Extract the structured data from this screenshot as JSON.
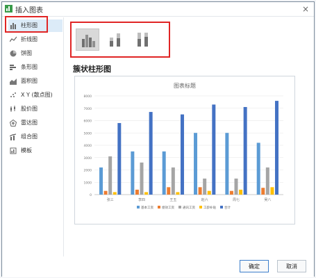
{
  "dialog": {
    "title": "插入图表",
    "close_glyph": "×"
  },
  "nav": {
    "items": [
      {
        "label": "柱形图",
        "icon": "column-chart-icon",
        "selected": true
      },
      {
        "label": "折线图",
        "icon": "line-chart-icon"
      },
      {
        "label": "饼图",
        "icon": "pie-chart-icon"
      },
      {
        "label": "条形图",
        "icon": "bar-chart-icon"
      },
      {
        "label": "面积图",
        "icon": "area-chart-icon"
      },
      {
        "label": "X Y (散点图)",
        "icon": "scatter-chart-icon"
      },
      {
        "label": "股价图",
        "icon": "stock-chart-icon"
      },
      {
        "label": "雷达图",
        "icon": "radar-chart-icon"
      },
      {
        "label": "组合图",
        "icon": "combo-chart-icon"
      },
      {
        "label": "模板",
        "icon": "template-icon"
      }
    ]
  },
  "subtypes": [
    "clustered-column",
    "stacked-column",
    "percent-stacked-column"
  ],
  "section_title": "簇状柱形图",
  "buttons": {
    "ok": "确定",
    "cancel": "取消"
  },
  "colors": {
    "accent_red": "#e02424",
    "series": [
      "#5b9bd5",
      "#ed7d31",
      "#a5a5a5",
      "#ffc000",
      "#4472c4"
    ]
  },
  "chart_data": {
    "type": "bar",
    "title": "图表标题",
    "categories": [
      "张三",
      "李四",
      "王五",
      "赵六",
      "周七",
      "吴八"
    ],
    "series": [
      {
        "name": "基本工资",
        "values": [
          2200,
          3500,
          3500,
          5000,
          5000,
          4200
        ]
      },
      {
        "name": "绩效工资",
        "values": [
          300,
          400,
          600,
          600,
          300,
          550
        ]
      },
      {
        "name": "通讯工资",
        "values": [
          3100,
          2600,
          2200,
          1300,
          1300,
          2200
        ]
      },
      {
        "name": "工龄补贴",
        "values": [
          200,
          200,
          200,
          300,
          400,
          600
        ]
      },
      {
        "name": "合计",
        "values": [
          5800,
          6700,
          6500,
          7300,
          7100,
          7600
        ]
      }
    ],
    "yticks": [
      "0",
      "1000",
      "2000",
      "3000",
      "4000",
      "5000",
      "6000",
      "7000",
      "8000"
    ],
    "ylim": [
      0,
      8000
    ],
    "grid": true,
    "legend_position": "bottom"
  }
}
